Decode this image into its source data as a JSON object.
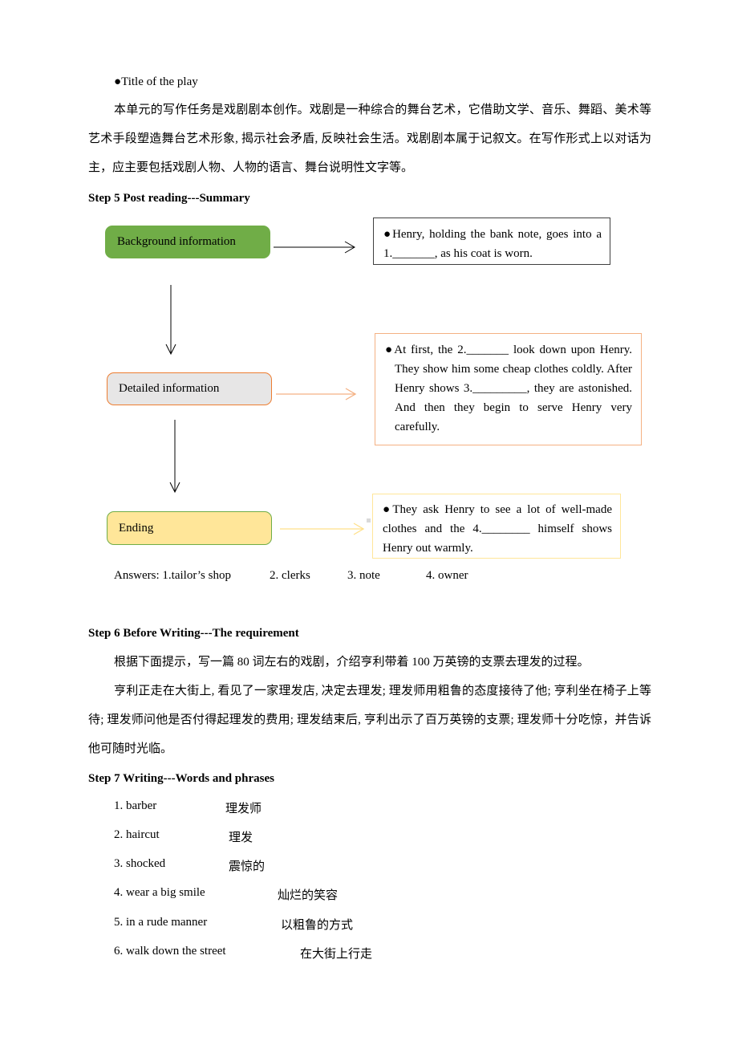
{
  "intro": {
    "bullet": "●",
    "title_item": "Title of the play",
    "paragraph": "本单元的写作任务是戏剧剧本创作。戏剧是一种综合的舞台艺术，它借助文学、音乐、舞蹈、美术等艺术手段塑造舞台艺术形象, 揭示社会矛盾, 反映社会生活。戏剧剧本属于记叙文。在写作形式上以对话为主，应主要包括戏剧人物、人物的语言、舞台说明性文字等。"
  },
  "step5": {
    "heading": "Step 5 Post reading---Summary",
    "flow": [
      {
        "label": "Background information",
        "fill": "#70ad47",
        "border": "#70ad47",
        "text": "●Henry, holding the bank note, goes into a 1._______, as his coat is worn.",
        "text_border": "#404040",
        "arrow_color": "#000000"
      },
      {
        "label": "Detailed information",
        "fill": "#e7e6e6",
        "border": "#ed7d31",
        "text": "●At first, the 2._______ look down upon Henry. They show him some cheap clothes coldly. After Henry shows 3._________, they are astonished. And then they begin to serve Henry very carefully.",
        "text_border": "#f4b183",
        "arrow_color": "#f4b183"
      },
      {
        "label": "Ending",
        "fill": "#ffe699",
        "border": "#70ad47",
        "text": "●They ask Henry to see a lot of well-made clothes and the 4.________ himself shows Henry out warmly.",
        "text_border": "#ffe699",
        "arrow_color": "#ffe699"
      }
    ],
    "answers": {
      "label": "Answers: 1.tailor’s shop",
      "a2": "2. clerks",
      "a3": "3. note",
      "a4": "4. owner"
    }
  },
  "step6": {
    "heading": "Step 6 Before Writing---The requirement",
    "p1": "根据下面提示，写一篇 80 词左右的戏剧，介绍亨利带着 100 万英镑的支票去理发的过程。",
    "p2": "亨利正走在大街上, 看见了一家理发店, 决定去理发; 理发师用粗鲁的态度接待了他; 亨利坐在椅子上等待; 理发师问他是否付得起理发的费用; 理发结束后, 亨利出示了百万英镑的支票; 理发师十分吃惊，并告诉他可随时光临。"
  },
  "step7": {
    "heading": "Step 7 Writing---Words and phrases",
    "words": [
      {
        "en": "1. barber",
        "zh": "理发师"
      },
      {
        "en": "2. haircut",
        "zh": "理发"
      },
      {
        "en": "3. shocked",
        "zh": "震惊的"
      },
      {
        "en": "4. wear a big smile",
        "zh": "灿烂的笑容"
      },
      {
        "en": "5. in a rude manner",
        "zh": "以粗鲁的方式"
      },
      {
        "en": "6. walk down the street",
        "zh": "在大街上行走"
      }
    ]
  }
}
